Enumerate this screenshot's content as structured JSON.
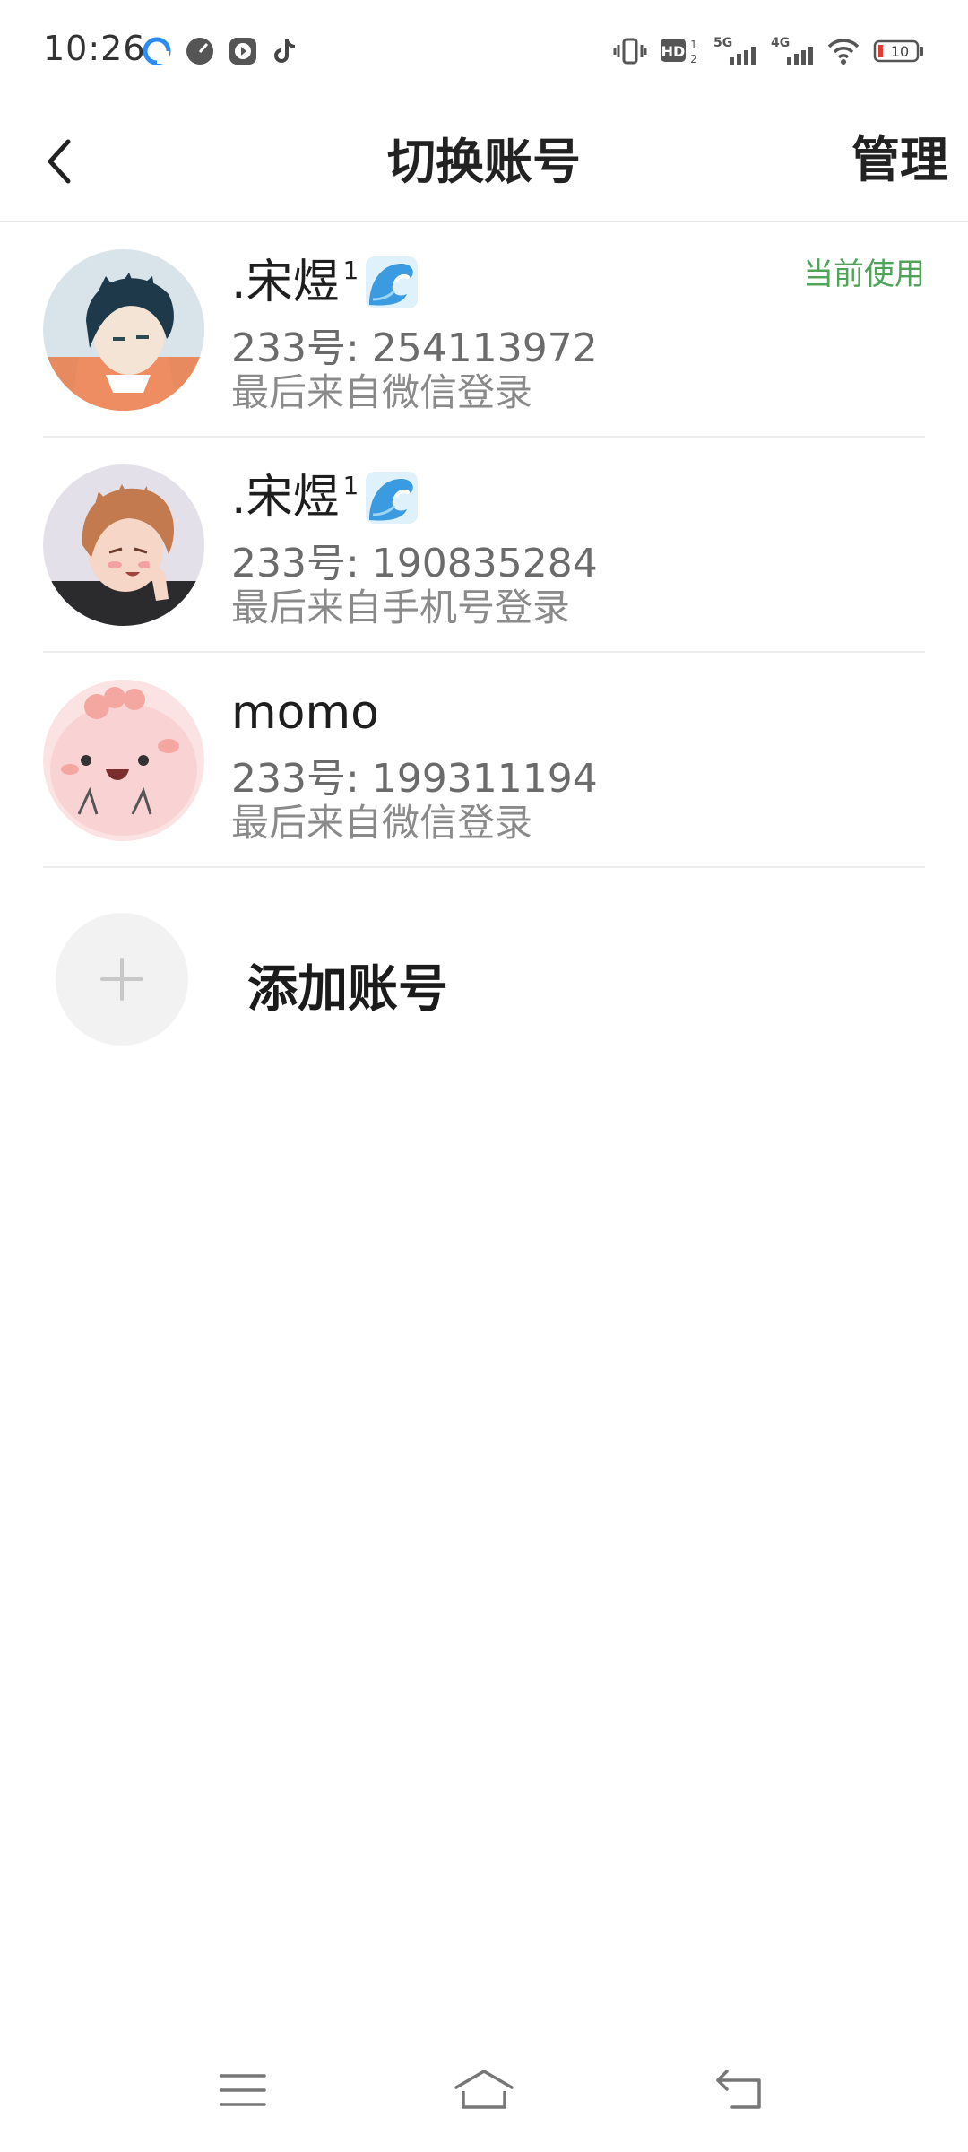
{
  "status_bar": {
    "time": "10:26",
    "notification_icons": [
      "browser-icon",
      "speed-icon",
      "video-icon",
      "tiktok-icon"
    ],
    "hd_label": "HD",
    "network_5g": "5G",
    "network_4g": "4G",
    "battery_level": "10",
    "battery_color": "#e53935"
  },
  "nav": {
    "title": "切换账号",
    "manage_label": "管理"
  },
  "accounts": [
    {
      "name": ".宋煜",
      "superscript": "1",
      "emoji": "wave-emoji",
      "id_text": "233号: 254113972",
      "login_text": "最后来自微信登录",
      "current_label": "当前使用"
    },
    {
      "name": ".宋煜",
      "superscript": "1",
      "emoji": "wave-emoji",
      "id_text": "233号: 190835284",
      "login_text": "最后来自手机号登录"
    },
    {
      "name": "momo",
      "id_text": "233号: 199311194",
      "login_text": "最后来自微信登录"
    }
  ],
  "add_account": {
    "label": "添加账号"
  },
  "colors": {
    "accent_green": "#4fa45a",
    "divider": "#ececec"
  },
  "bottom_nav": [
    "menu-icon",
    "home-icon",
    "back-nav-icon"
  ]
}
